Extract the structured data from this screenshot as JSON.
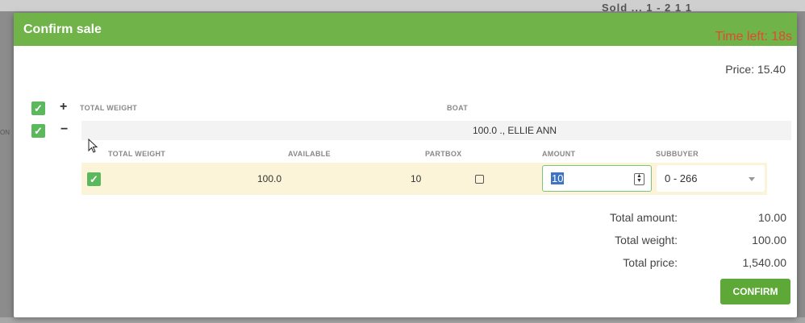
{
  "background": {
    "top_text": "Sold ... 1 - 2 1 1",
    "left_tag": "ON"
  },
  "modal": {
    "title": "Confirm sale",
    "time_left": "Time left: 18s",
    "price": "Price: 15.40"
  },
  "group_header": {
    "total_weight": "TOTAL WEIGHT",
    "boat": "BOAT"
  },
  "boat_row": {
    "label": "100.0 ., ELLIE ANN"
  },
  "lot_header": {
    "total_weight": "TOTAL WEIGHT",
    "available": "AVAILABLE",
    "partbox": "PARTBOX",
    "amount": "AMOUNT",
    "subbuyer": "SUBBUYER"
  },
  "lot_row": {
    "available": "100.0",
    "partbox": "10",
    "amount": "10",
    "subbuyer": "0 - 266"
  },
  "totals": {
    "amount_label": "Total amount:",
    "amount_value": "10.00",
    "weight_label": "Total weight:",
    "weight_value": "100.00",
    "price_label": "Total price:",
    "price_value": "1,540.00"
  },
  "confirm_label": "CONFIRM",
  "colors": {
    "header_green": "#6fb349",
    "timer_red": "#e04b2f",
    "check_green": "#5cb85c",
    "row_highlight": "#fbf4d9"
  }
}
